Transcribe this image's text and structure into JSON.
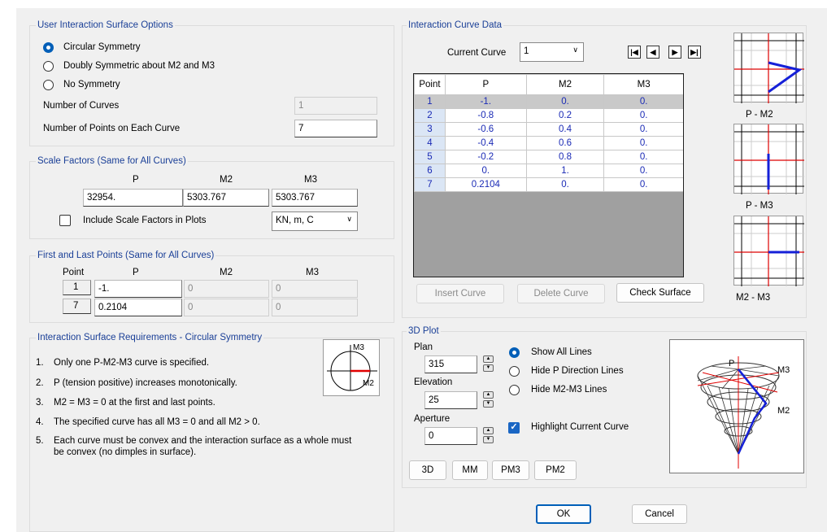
{
  "surface_options": {
    "title": "User Interaction Surface Options",
    "radios": [
      {
        "label": "Circular Symmetry",
        "checked": true
      },
      {
        "label": "Doubly Symmetric about M2 and M3",
        "checked": false
      },
      {
        "label": "No Symmetry",
        "checked": false
      }
    ],
    "num_curves_label": "Number of Curves",
    "num_curves": "1",
    "num_points_label": "Number of Points on Each Curve",
    "num_points": "7"
  },
  "scale": {
    "title": "Scale Factors (Same for All Curves)",
    "headers": [
      "P",
      "M2",
      "M3"
    ],
    "values": [
      "32954.",
      "5303.767",
      "5303.767"
    ],
    "include_label": "Include Scale Factors in Plots",
    "units": "KN, m, C"
  },
  "firstlast": {
    "title": "First and Last Points (Same for All Curves)",
    "headers": [
      "Point",
      "P",
      "M2",
      "M3"
    ],
    "rows": [
      {
        "point": "1",
        "p": "-1.",
        "m2": "0",
        "m3": "0"
      },
      {
        "point": "7",
        "p": "0.2104",
        "m2": "0",
        "m3": "0"
      }
    ]
  },
  "requirements": {
    "title": "Interaction Surface Requirements - Circular Symmetry",
    "items": [
      {
        "n": "1.",
        "text": "Only one P-M2-M3 curve is specified."
      },
      {
        "n": "2.",
        "text": "P (tension positive) increases monotonically."
      },
      {
        "n": "3.",
        "text": "M2 = M3 = 0 at the first and last points."
      },
      {
        "n": "4.",
        "text": "The specified curve has all M3 = 0 and all M2 > 0."
      },
      {
        "n": "5.",
        "text": "Each curve must be convex and the interaction surface as a whole must"
      },
      {
        "n": "",
        "text": "be convex (no dimples in surface)."
      }
    ],
    "diagram_m3": "M3",
    "diagram_m2": "M2"
  },
  "curve_data": {
    "title": "Interaction Curve Data",
    "current_label": "Current Curve",
    "current_value": "1",
    "headers": [
      "Point",
      "P",
      "M2",
      "M3"
    ],
    "rows": [
      [
        "1",
        "-1.",
        "0.",
        "0."
      ],
      [
        "2",
        "-0.8",
        "0.2",
        "0."
      ],
      [
        "3",
        "-0.6",
        "0.4",
        "0."
      ],
      [
        "4",
        "-0.4",
        "0.6",
        "0."
      ],
      [
        "5",
        "-0.2",
        "0.8",
        "0."
      ],
      [
        "6",
        "0.",
        "1.",
        "0."
      ],
      [
        "7",
        "0.2104",
        "0.",
        "0."
      ]
    ],
    "insert": "Insert Curve",
    "delete": "Delete Curve",
    "check": "Check Surface"
  },
  "mini_plots": [
    "P - M2",
    "P - M3",
    "M2 - M3"
  ],
  "plot3d": {
    "title": "3D Plot",
    "plan_label": "Plan",
    "plan": "315",
    "elev_label": "Elevation",
    "elev": "25",
    "aperture_label": "Aperture",
    "aperture": "0",
    "options": [
      {
        "label": "Show All Lines",
        "checked": true
      },
      {
        "label": "Hide P Direction Lines",
        "checked": false
      },
      {
        "label": "Hide M2-M3 Lines",
        "checked": false
      }
    ],
    "highlight": "Highlight Current Curve",
    "buttons": [
      "3D",
      "MM",
      "PM3",
      "PM2"
    ],
    "labels": {
      "p": "P",
      "m3": "M3",
      "m2": "M2"
    }
  },
  "dialog": {
    "ok": "OK",
    "cancel": "Cancel"
  }
}
